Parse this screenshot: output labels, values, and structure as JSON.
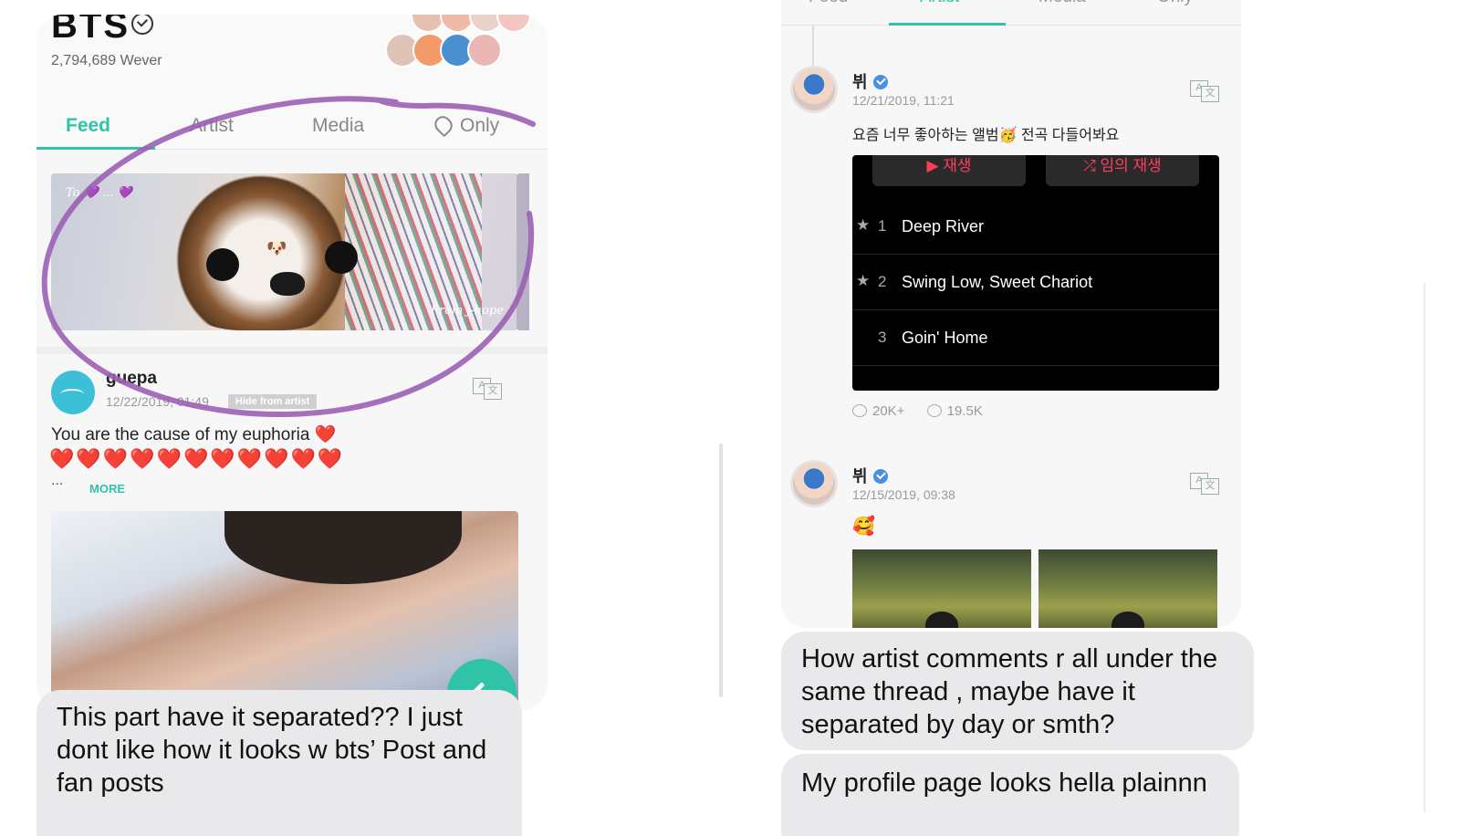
{
  "left_screen": {
    "artist": {
      "name": "BTS",
      "follower_count": "2,794,689 Wever"
    },
    "tabs": [
      {
        "label": "Feed",
        "active": true
      },
      {
        "label": "Artist",
        "active": false
      },
      {
        "label": "Media",
        "active": false
      },
      {
        "label": "Only",
        "active": false,
        "icon": "heart-outline-icon"
      }
    ],
    "banner": {
      "caption": "To 💜 ... 💜",
      "signature": "From j-hope",
      "dog_emoji": "🐶"
    },
    "post": {
      "user": "guepa",
      "time": "12/22/2019, 01:49",
      "chip": "Hide from artist",
      "text": "You are the cause of my euphoria ❤️",
      "hearts": "❤️❤️❤️❤️❤️❤️❤️❤️❤️❤️❤️",
      "ellipsis": "...",
      "more_label": "MORE"
    },
    "annotation_color": "#9b5fb5",
    "accent_color": "#2fc4a8"
  },
  "messages": {
    "left": "This part have it separated?? I just dont like how it looks w bts’ Post and fan posts",
    "right_1": "How artist comments r all under the same thread , maybe have it separated by day or smth?",
    "right_2": "My profile page looks hella plainnn"
  },
  "right_screen": {
    "tabs": [
      {
        "label": "Feed",
        "active": false
      },
      {
        "label": "Artist",
        "active": true
      },
      {
        "label": "Media",
        "active": false
      },
      {
        "label": "Only",
        "active": false
      }
    ],
    "posts": [
      {
        "user": "뷔",
        "time": "12/21/2019, 11:21",
        "text": "요즘 너무 좋아하는 앨범🥳 전곡 다들어봐요",
        "playlist": {
          "play_label": "▶ 재생",
          "shuffle_label": "⤮ 임의 재생",
          "tracks": [
            {
              "num": "1",
              "title": "Deep River",
              "starred": true
            },
            {
              "num": "2",
              "title": "Swing Low, Sweet Chariot",
              "starred": true
            },
            {
              "num": "3",
              "title": "Goin' Home",
              "starred": false
            }
          ]
        },
        "likes": "20K+",
        "comments": "19.5K"
      },
      {
        "user": "뷔",
        "time": "12/15/2019, 09:38",
        "text": "🥰"
      }
    ]
  }
}
